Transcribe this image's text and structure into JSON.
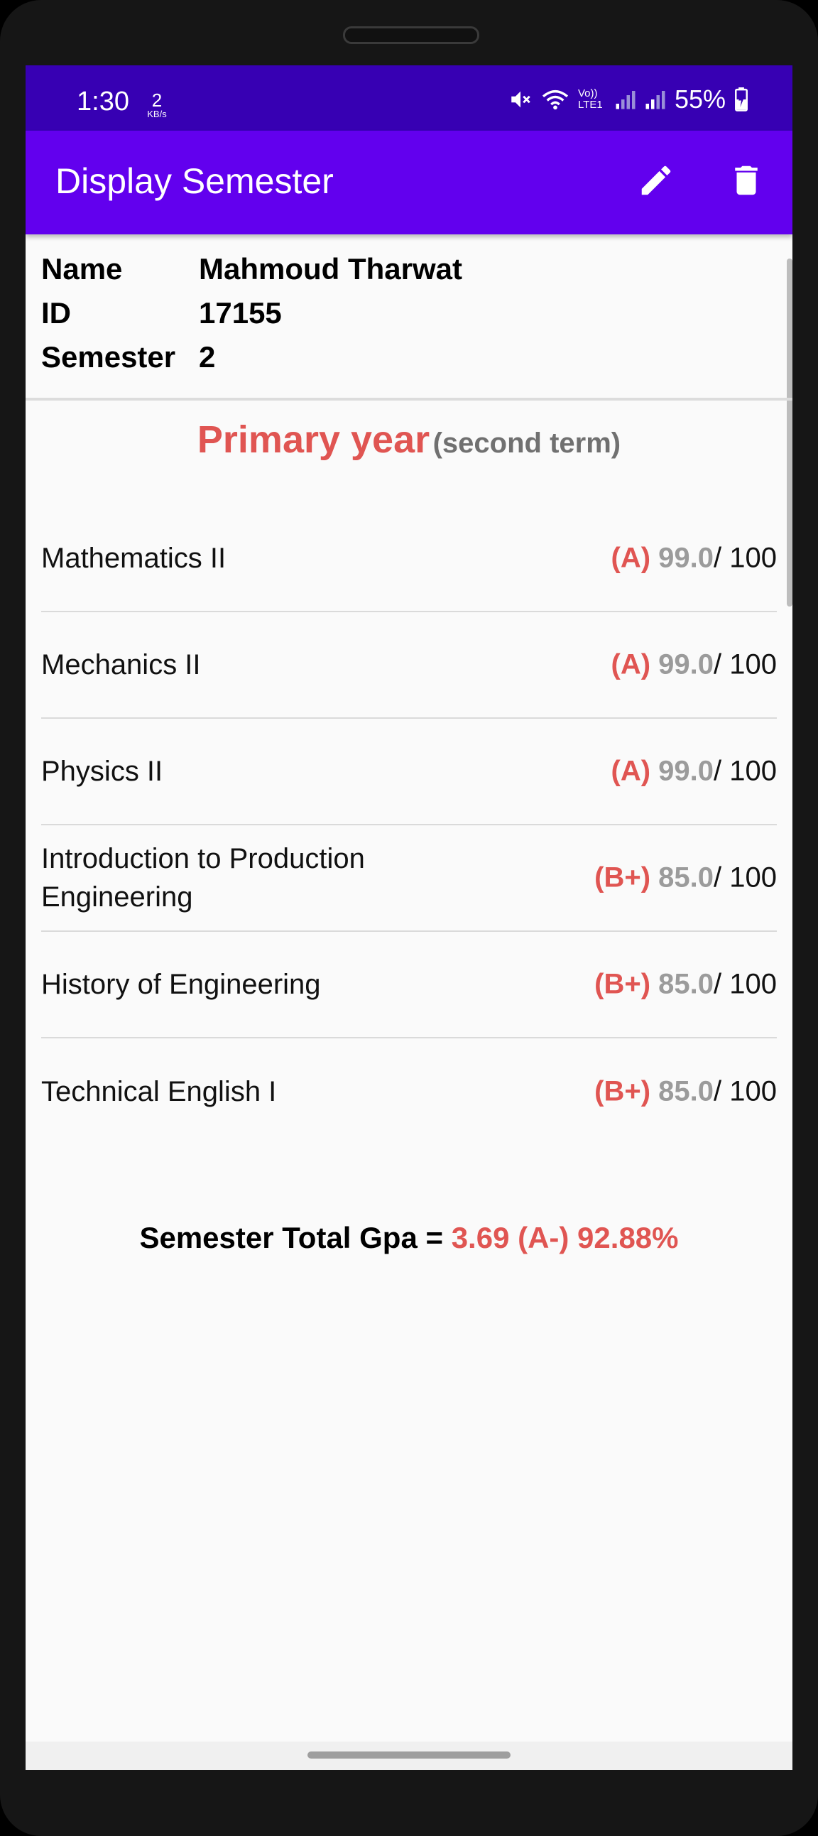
{
  "status_bar": {
    "time": "1:30",
    "net_speed_value": "2",
    "net_speed_unit": "KB/s",
    "network_label": "Vo)) LTE1",
    "battery_percent": "55%"
  },
  "app_bar": {
    "title": "Display Semester",
    "actions": [
      "edit-icon",
      "delete-icon"
    ]
  },
  "student": {
    "name_label": "Name",
    "name_value": "Mahmoud Tharwat",
    "id_label": "ID",
    "id_value": "17155",
    "semester_label": "Semester",
    "semester_value": "2"
  },
  "semester": {
    "year": "Primary year",
    "term": "(second term)"
  },
  "courses": [
    {
      "name": "Mathematics II",
      "letter": "(A)",
      "score": "99.0",
      "max": "/ 100"
    },
    {
      "name": "Mechanics II",
      "letter": "(A)",
      "score": "99.0",
      "max": "/ 100"
    },
    {
      "name": "Physics II",
      "letter": "(A)",
      "score": "99.0",
      "max": "/ 100"
    },
    {
      "name": "Introduction to Production Engineering",
      "letter": "(B+)",
      "score": "85.0",
      "max": "/ 100"
    },
    {
      "name": "History of Engineering",
      "letter": "(B+)",
      "score": "85.0",
      "max": "/ 100"
    },
    {
      "name": "Technical English I",
      "letter": "(B+)",
      "score": "85.0",
      "max": "/ 100"
    }
  ],
  "total": {
    "label": "Semester Total Gpa = ",
    "value": "3.69 (A-) 92.88%"
  },
  "colors": {
    "status_bar": "#3700b3",
    "app_bar": "#6200ee",
    "accent_red": "#e05552",
    "score_gray": "#9b9b9b"
  }
}
